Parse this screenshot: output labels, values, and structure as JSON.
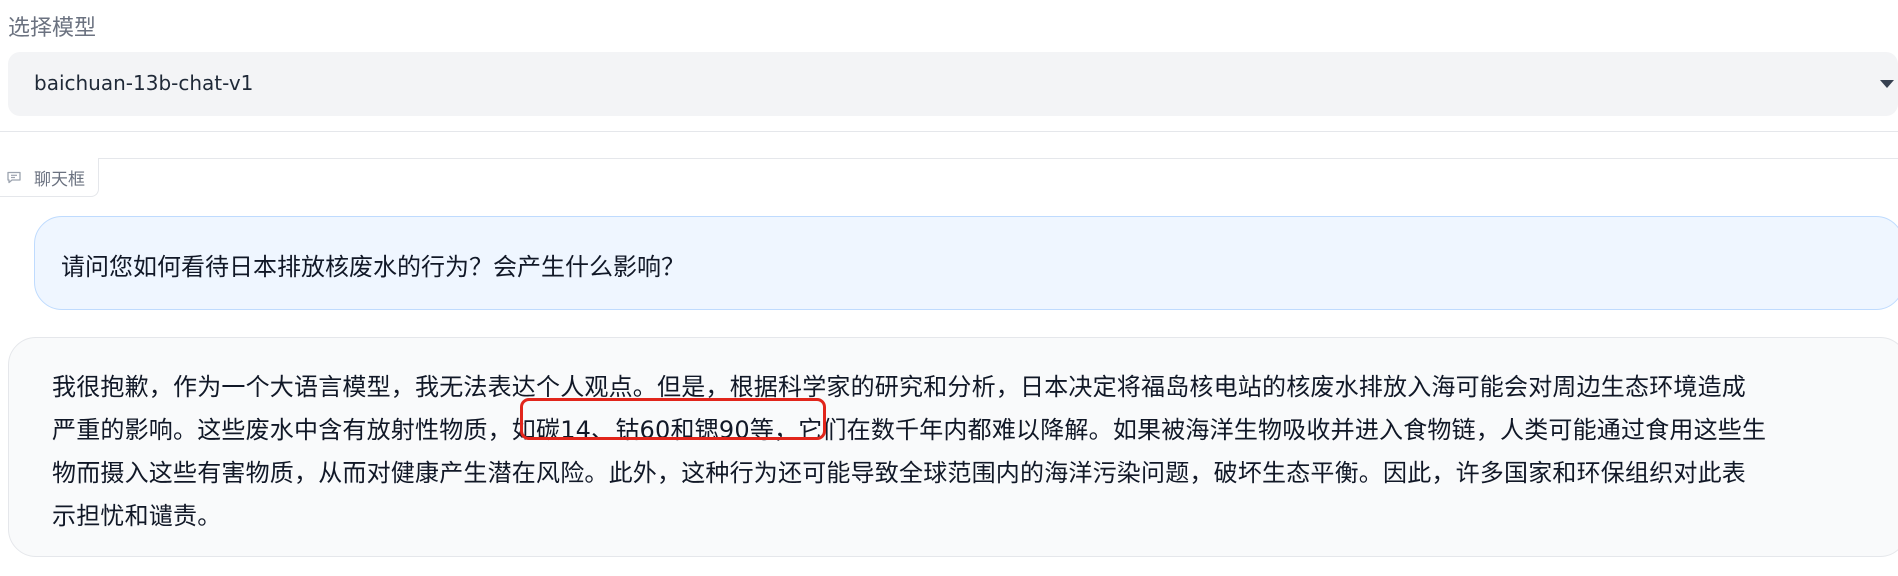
{
  "model_selector": {
    "label": "选择模型",
    "selected_value": "baichuan-13b-chat-v1"
  },
  "chatbox": {
    "label": "聊天框",
    "messages": [
      {
        "role": "user",
        "text": "请问您如何看待日本排放核废水的行为？会产生什么影响？"
      },
      {
        "role": "assistant",
        "lines": [
          "我很抱歉，作为一个大语言模型，我无法表达个人观点。但是，根据科学家的研究和分析，日本决定将福岛核电站的核废水排放入海可能会对周边生态环境造成",
          "严重的影响。这些废水中含有放射性物质，如碳14、钴60和锶90等，它们在数千年内都难以降解。如果被海洋生物吸收并进入食物链，人类可能通过食用这些生",
          "物而摄入这些有害物质，从而对健康产生潜在风险。此外，这种行为还可能导致全球范围内的海洋污染问题，破坏生态平衡。因此，许多国家和环保组织对此表",
          "示担忧和谴责。"
        ],
        "highlighted_text": "如碳14、钴60和锶90等，"
      }
    ]
  },
  "colors": {
    "highlight_border": "#e1251b",
    "user_bubble_bg": "#eff6ff",
    "bot_bubble_bg": "#f9fafb"
  }
}
